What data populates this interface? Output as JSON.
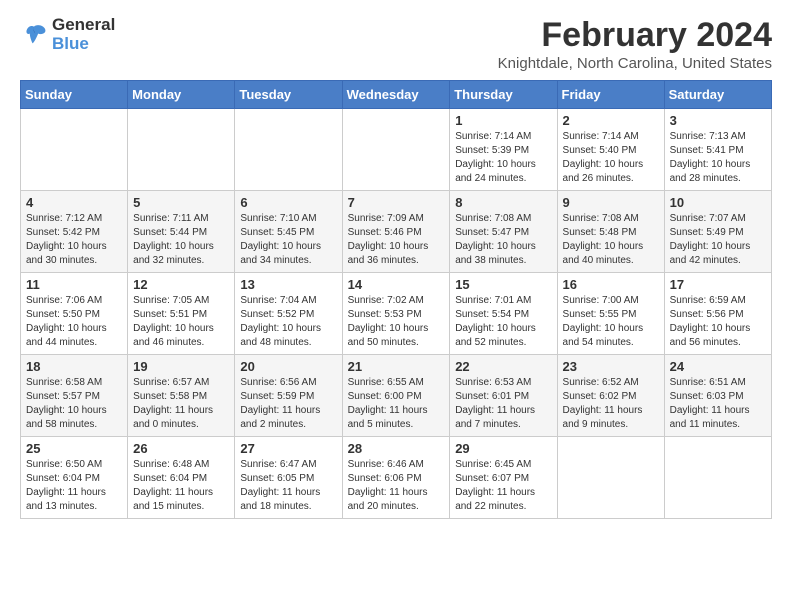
{
  "logo": {
    "line1": "General",
    "line2": "Blue"
  },
  "title": "February 2024",
  "location": "Knightdale, North Carolina, United States",
  "weekdays": [
    "Sunday",
    "Monday",
    "Tuesday",
    "Wednesday",
    "Thursday",
    "Friday",
    "Saturday"
  ],
  "weeks": [
    [
      {
        "day": "",
        "info": ""
      },
      {
        "day": "",
        "info": ""
      },
      {
        "day": "",
        "info": ""
      },
      {
        "day": "",
        "info": ""
      },
      {
        "day": "1",
        "info": "Sunrise: 7:14 AM\nSunset: 5:39 PM\nDaylight: 10 hours\nand 24 minutes."
      },
      {
        "day": "2",
        "info": "Sunrise: 7:14 AM\nSunset: 5:40 PM\nDaylight: 10 hours\nand 26 minutes."
      },
      {
        "day": "3",
        "info": "Sunrise: 7:13 AM\nSunset: 5:41 PM\nDaylight: 10 hours\nand 28 minutes."
      }
    ],
    [
      {
        "day": "4",
        "info": "Sunrise: 7:12 AM\nSunset: 5:42 PM\nDaylight: 10 hours\nand 30 minutes."
      },
      {
        "day": "5",
        "info": "Sunrise: 7:11 AM\nSunset: 5:44 PM\nDaylight: 10 hours\nand 32 minutes."
      },
      {
        "day": "6",
        "info": "Sunrise: 7:10 AM\nSunset: 5:45 PM\nDaylight: 10 hours\nand 34 minutes."
      },
      {
        "day": "7",
        "info": "Sunrise: 7:09 AM\nSunset: 5:46 PM\nDaylight: 10 hours\nand 36 minutes."
      },
      {
        "day": "8",
        "info": "Sunrise: 7:08 AM\nSunset: 5:47 PM\nDaylight: 10 hours\nand 38 minutes."
      },
      {
        "day": "9",
        "info": "Sunrise: 7:08 AM\nSunset: 5:48 PM\nDaylight: 10 hours\nand 40 minutes."
      },
      {
        "day": "10",
        "info": "Sunrise: 7:07 AM\nSunset: 5:49 PM\nDaylight: 10 hours\nand 42 minutes."
      }
    ],
    [
      {
        "day": "11",
        "info": "Sunrise: 7:06 AM\nSunset: 5:50 PM\nDaylight: 10 hours\nand 44 minutes."
      },
      {
        "day": "12",
        "info": "Sunrise: 7:05 AM\nSunset: 5:51 PM\nDaylight: 10 hours\nand 46 minutes."
      },
      {
        "day": "13",
        "info": "Sunrise: 7:04 AM\nSunset: 5:52 PM\nDaylight: 10 hours\nand 48 minutes."
      },
      {
        "day": "14",
        "info": "Sunrise: 7:02 AM\nSunset: 5:53 PM\nDaylight: 10 hours\nand 50 minutes."
      },
      {
        "day": "15",
        "info": "Sunrise: 7:01 AM\nSunset: 5:54 PM\nDaylight: 10 hours\nand 52 minutes."
      },
      {
        "day": "16",
        "info": "Sunrise: 7:00 AM\nSunset: 5:55 PM\nDaylight: 10 hours\nand 54 minutes."
      },
      {
        "day": "17",
        "info": "Sunrise: 6:59 AM\nSunset: 5:56 PM\nDaylight: 10 hours\nand 56 minutes."
      }
    ],
    [
      {
        "day": "18",
        "info": "Sunrise: 6:58 AM\nSunset: 5:57 PM\nDaylight: 10 hours\nand 58 minutes."
      },
      {
        "day": "19",
        "info": "Sunrise: 6:57 AM\nSunset: 5:58 PM\nDaylight: 11 hours\nand 0 minutes."
      },
      {
        "day": "20",
        "info": "Sunrise: 6:56 AM\nSunset: 5:59 PM\nDaylight: 11 hours\nand 2 minutes."
      },
      {
        "day": "21",
        "info": "Sunrise: 6:55 AM\nSunset: 6:00 PM\nDaylight: 11 hours\nand 5 minutes."
      },
      {
        "day": "22",
        "info": "Sunrise: 6:53 AM\nSunset: 6:01 PM\nDaylight: 11 hours\nand 7 minutes."
      },
      {
        "day": "23",
        "info": "Sunrise: 6:52 AM\nSunset: 6:02 PM\nDaylight: 11 hours\nand 9 minutes."
      },
      {
        "day": "24",
        "info": "Sunrise: 6:51 AM\nSunset: 6:03 PM\nDaylight: 11 hours\nand 11 minutes."
      }
    ],
    [
      {
        "day": "25",
        "info": "Sunrise: 6:50 AM\nSunset: 6:04 PM\nDaylight: 11 hours\nand 13 minutes."
      },
      {
        "day": "26",
        "info": "Sunrise: 6:48 AM\nSunset: 6:04 PM\nDaylight: 11 hours\nand 15 minutes."
      },
      {
        "day": "27",
        "info": "Sunrise: 6:47 AM\nSunset: 6:05 PM\nDaylight: 11 hours\nand 18 minutes."
      },
      {
        "day": "28",
        "info": "Sunrise: 6:46 AM\nSunset: 6:06 PM\nDaylight: 11 hours\nand 20 minutes."
      },
      {
        "day": "29",
        "info": "Sunrise: 6:45 AM\nSunset: 6:07 PM\nDaylight: 11 hours\nand 22 minutes."
      },
      {
        "day": "",
        "info": ""
      },
      {
        "day": "",
        "info": ""
      }
    ]
  ]
}
